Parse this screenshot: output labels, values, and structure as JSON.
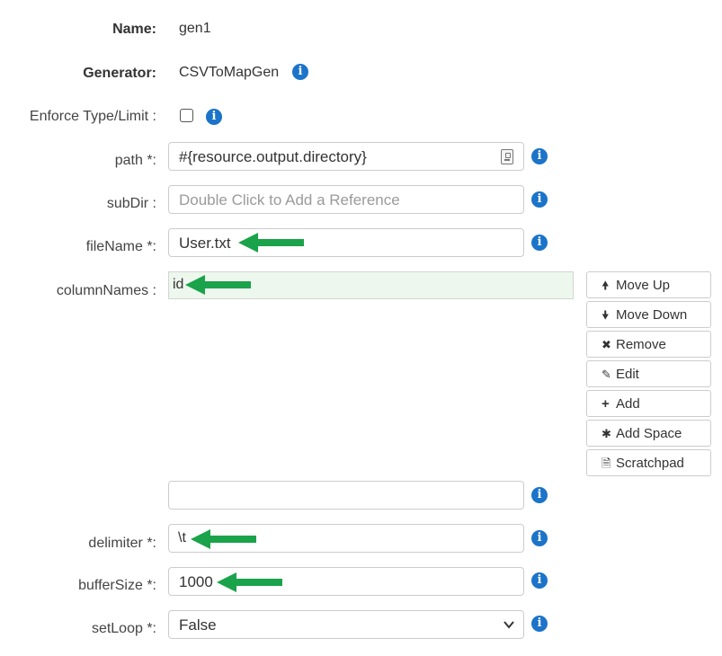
{
  "form": {
    "name": {
      "label": "Name:",
      "value": "gen1"
    },
    "generator": {
      "label": "Generator:",
      "value": "CSVToMapGen"
    },
    "enforce": {
      "label": "Enforce Type/Limit :",
      "checked": false
    },
    "path": {
      "label": "path *:",
      "value": "#{resource.output.directory}"
    },
    "subDir": {
      "label": "subDir :",
      "value": "",
      "placeholder": "Double Click to Add a Reference"
    },
    "fileName": {
      "label": "fileName *:",
      "value": "User.txt"
    },
    "columnNames": {
      "label": "columnNames :",
      "items": [
        "id"
      ],
      "new_value": ""
    },
    "delimiter": {
      "label": "delimiter *:",
      "value": "\\t"
    },
    "bufferSize": {
      "label": "bufferSize *:",
      "value": "1000"
    },
    "setLoop": {
      "label": "setLoop *:",
      "value": "False"
    }
  },
  "list_buttons": {
    "move_up": "Move Up",
    "move_down": "Move Down",
    "remove": "Remove",
    "edit": "Edit",
    "add": "Add",
    "add_space": "Add Space",
    "scratchpad": "Scratchpad"
  },
  "icons": {
    "info": "info-icon",
    "annotation_arrow": "arrow-left-icon",
    "annotation_color": "#1aa34a",
    "info_color": "#1b74c9"
  }
}
